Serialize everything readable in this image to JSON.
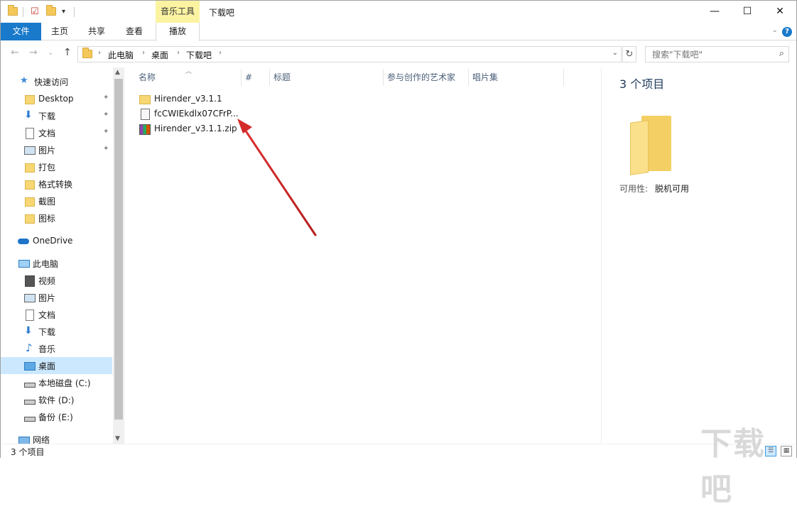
{
  "titlebar": {
    "context_tab": "音乐工具",
    "title": "下载吧",
    "min": "—",
    "max": "☐",
    "close": "✕"
  },
  "ribbon": {
    "tabs": [
      "文件",
      "主页",
      "共享",
      "查看",
      "播放"
    ],
    "help": "?"
  },
  "address": {
    "crumbs": [
      "此电脑",
      "桌面",
      "下载吧"
    ],
    "search_placeholder": "搜索\"下载吧\""
  },
  "sidebar": {
    "items": [
      {
        "label": "快速访问",
        "icon": "star-icon"
      },
      {
        "label": "Desktop",
        "icon": "folder-icon",
        "pinned": true
      },
      {
        "label": "下载",
        "icon": "download-icon",
        "pinned": true
      },
      {
        "label": "文档",
        "icon": "document-icon",
        "pinned": true
      },
      {
        "label": "图片",
        "icon": "picture-icon",
        "pinned": true
      },
      {
        "label": "打包",
        "icon": "folder-icon"
      },
      {
        "label": "格式转换",
        "icon": "folder-icon"
      },
      {
        "label": "截图",
        "icon": "folder-icon"
      },
      {
        "label": "图标",
        "icon": "folder-icon"
      },
      {
        "label": "OneDrive",
        "icon": "cloud-icon"
      },
      {
        "label": "此电脑",
        "icon": "computer-icon"
      },
      {
        "label": "视频",
        "icon": "video-icon"
      },
      {
        "label": "图片",
        "icon": "picture-icon"
      },
      {
        "label": "文档",
        "icon": "document-icon"
      },
      {
        "label": "下载",
        "icon": "download-icon"
      },
      {
        "label": "音乐",
        "icon": "music-icon"
      },
      {
        "label": "桌面",
        "icon": "desktop-icon",
        "selected": true
      },
      {
        "label": "本地磁盘 (C:)",
        "icon": "drive-icon"
      },
      {
        "label": "软件 (D:)",
        "icon": "drive-icon"
      },
      {
        "label": "备份 (E:)",
        "icon": "drive-icon"
      },
      {
        "label": "网络",
        "icon": "network-icon"
      }
    ]
  },
  "columns": [
    "名称",
    "#",
    "标题",
    "参与创作的艺术家",
    "唱片集"
  ],
  "files": [
    {
      "name": "Hirender_v3.1.1",
      "type": "folder"
    },
    {
      "name": "fcCWIEkdlx07CFrP...",
      "type": "file"
    },
    {
      "name": "Hirender_v3.1.1.zip",
      "type": "zip"
    }
  ],
  "preview": {
    "count": "3 个项目",
    "availability_label": "可用性:",
    "availability_value": "脱机可用"
  },
  "status": {
    "count": "3 个项目"
  },
  "watermark": "下载吧",
  "colors": {
    "accent": "#1979ca",
    "context_tab_bg": "#fbf3a1",
    "selection": "#cce8ff",
    "annotation_arrow": "#d42a2a"
  }
}
